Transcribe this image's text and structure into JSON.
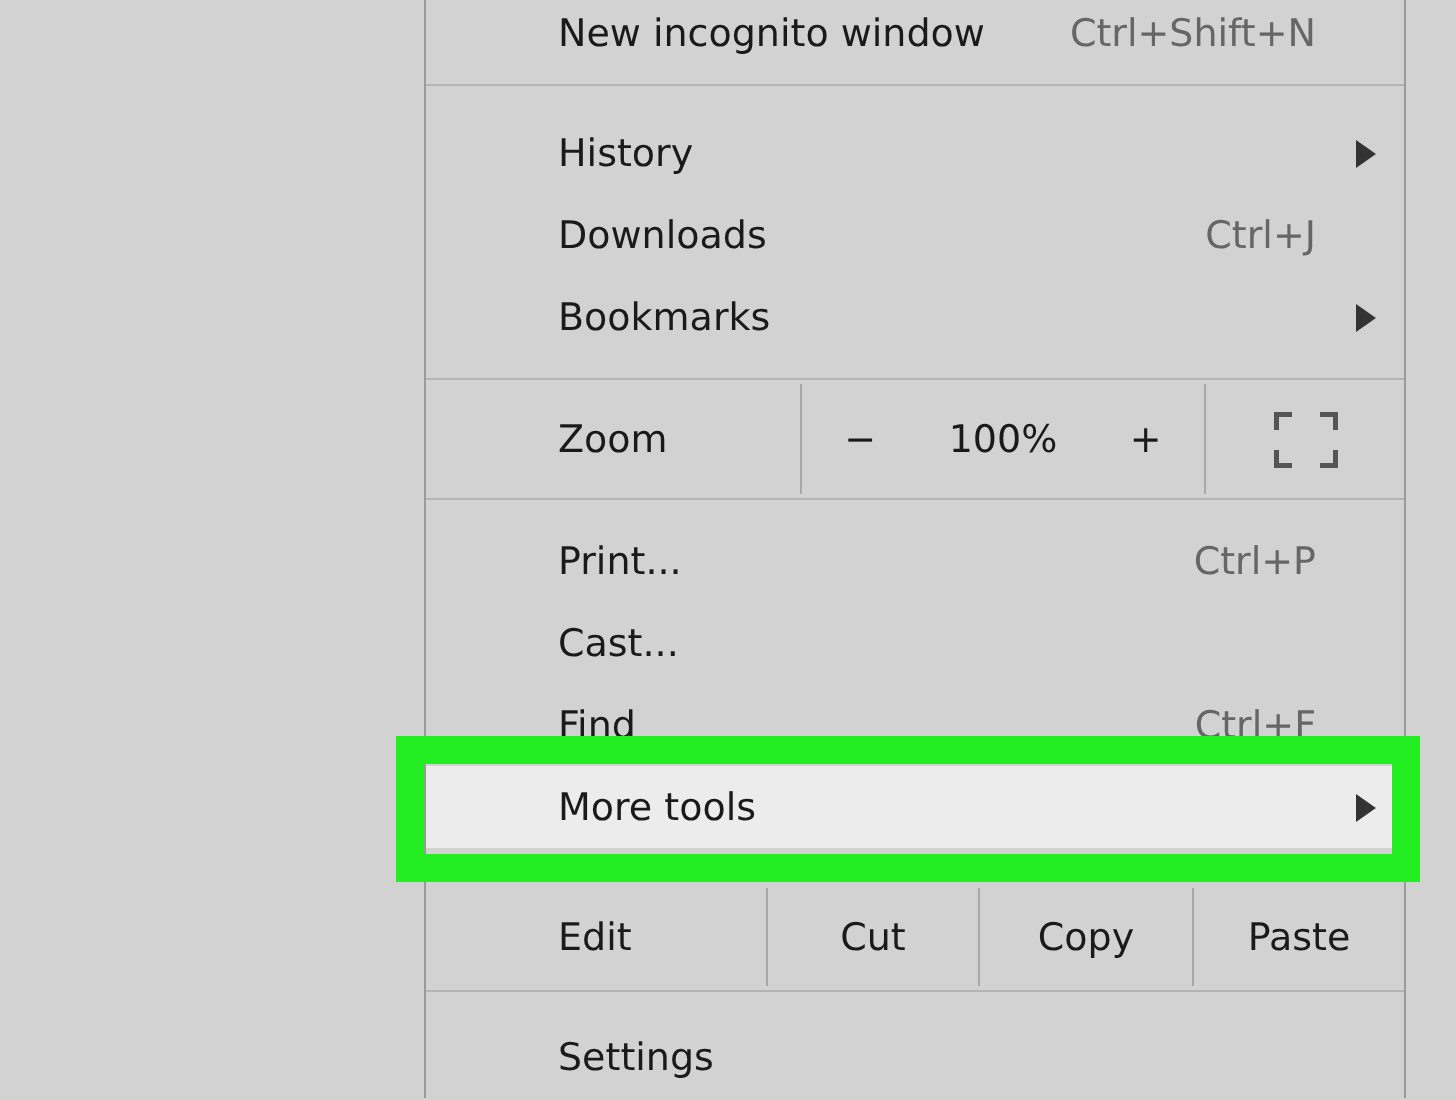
{
  "menu": {
    "sections": [
      {
        "kind": "items",
        "items": [
          {
            "label": "New incognito window",
            "shortcut": "Ctrl+Shift+N",
            "submenu": false,
            "highlighted": false
          }
        ]
      },
      {
        "kind": "items",
        "items": [
          {
            "label": "History",
            "submenu": true,
            "highlighted": false
          },
          {
            "label": "Downloads",
            "shortcut": "Ctrl+J",
            "submenu": false,
            "highlighted": false
          },
          {
            "label": "Bookmarks",
            "submenu": true,
            "highlighted": false
          }
        ]
      },
      {
        "kind": "zoom",
        "label": "Zoom",
        "decrease": "−",
        "value": "100%",
        "increase": "+"
      },
      {
        "kind": "items",
        "items": [
          {
            "label": "Print...",
            "shortcut": "Ctrl+P",
            "submenu": false,
            "highlighted": false
          },
          {
            "label": "Cast...",
            "submenu": false,
            "highlighted": false
          },
          {
            "label": "Find",
            "shortcut": "Ctrl+F",
            "submenu": false,
            "highlighted": false
          },
          {
            "label": "More tools",
            "submenu": true,
            "highlighted": true
          }
        ]
      },
      {
        "kind": "edit",
        "label": "Edit",
        "actions": [
          "Cut",
          "Copy",
          "Paste"
        ]
      },
      {
        "kind": "items",
        "items": [
          {
            "label": "Settings",
            "submenu": false,
            "highlighted": false
          }
        ]
      }
    ]
  }
}
